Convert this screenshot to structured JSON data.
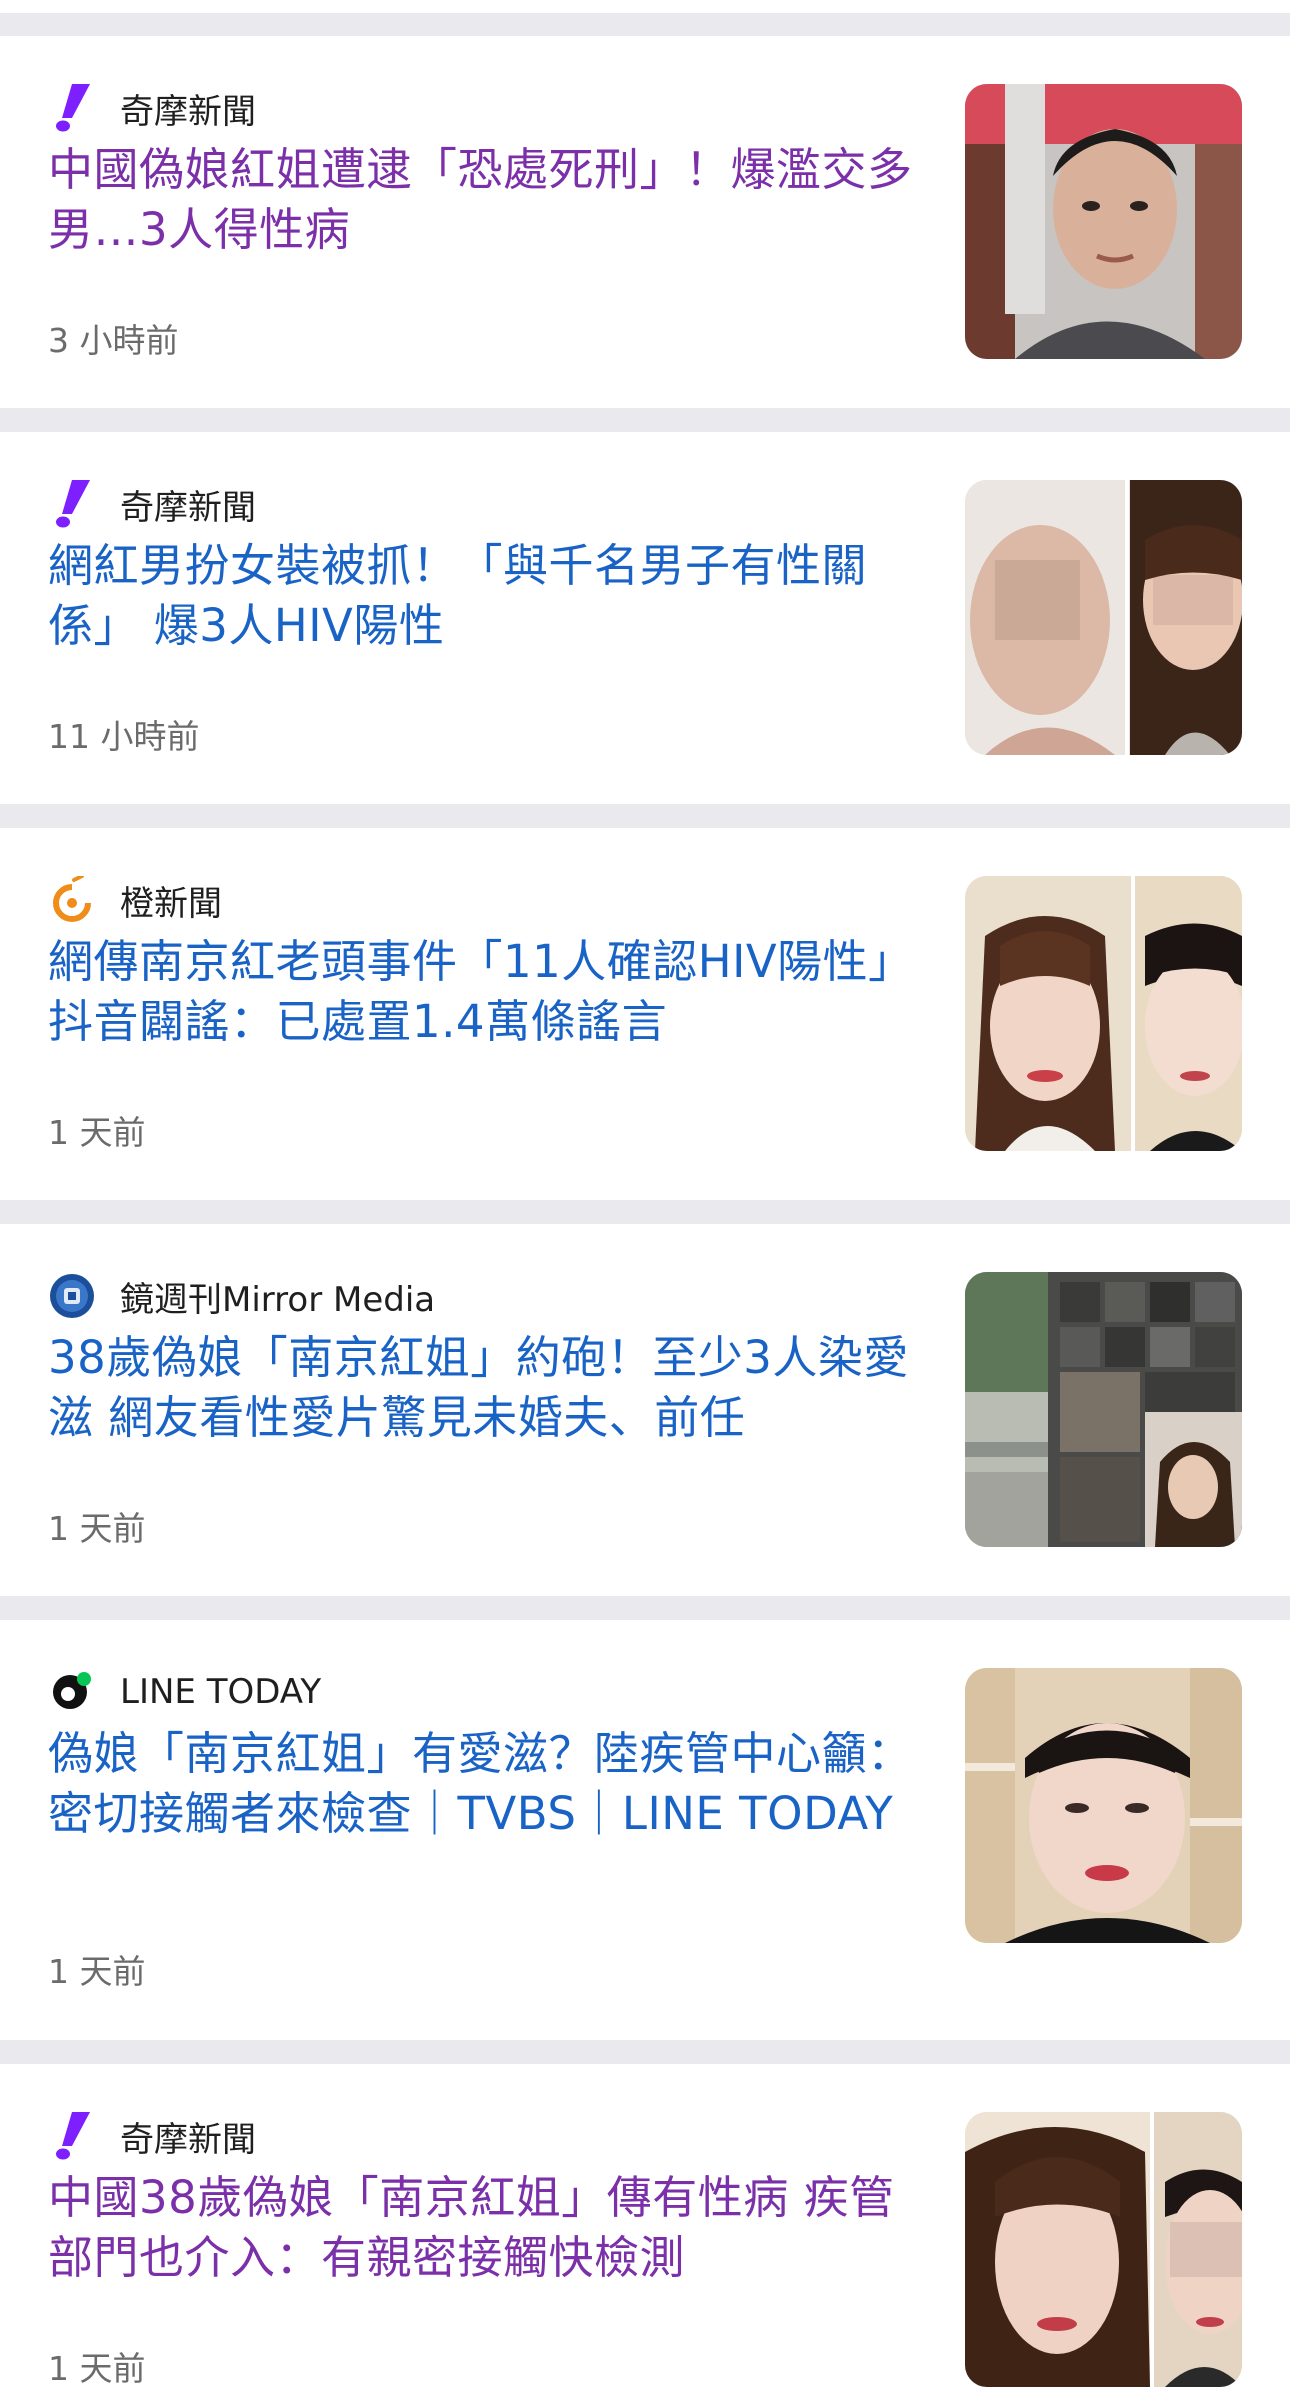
{
  "articles": [
    {
      "source": "奇摩新聞",
      "source_icon": "yahoo-exclamation-icon",
      "title": "中國偽娘紅姐遭逮「恐處死刑」！爆濫交多男…3人得性病",
      "time": "3 小時前",
      "visited": true,
      "thumbnail": "man-selfie-thumbnail"
    },
    {
      "source": "奇摩新聞",
      "source_icon": "yahoo-exclamation-icon",
      "title": "網紅男扮女裝被抓！「與千名男子有性關係」 爆3人HIV陽性",
      "time": "11 小時前",
      "visited": false,
      "thumbnail": "split-faces-thumbnail"
    },
    {
      "source": "橙新聞",
      "source_icon": "orange-news-icon",
      "title": "網傳南京紅老頭事件「11人確認HIV陽性」 抖音闢謠：已處置1.4萬條謠言",
      "time": "1 天前",
      "visited": false,
      "thumbnail": "split-faces-thumbnail"
    },
    {
      "source": "鏡週刊Mirror Media",
      "source_icon": "mirror-media-icon",
      "title": "38歲偽娘「南京紅姐」約砲！至少3人染愛滋 網友看性愛片驚見未婚夫、前任",
      "time": "1 天前",
      "visited": false,
      "thumbnail": "collage-thumbnail"
    },
    {
      "source": "LINE TODAY",
      "source_icon": "line-today-icon",
      "title": "偽娘「南京紅姐」有愛滋？陸疾管中心籲：密切接觸者來檢查｜TVBS｜LINE TODAY",
      "time": "1 天前",
      "visited": false,
      "thumbnail": "face-closeup-thumbnail"
    },
    {
      "source": "奇摩新聞",
      "source_icon": "yahoo-exclamation-icon",
      "title": "中國38歲偽娘「南京紅姐」傳有性病 疾管部門也介入：有親密接觸快檢測",
      "time": "1 天前",
      "visited": true,
      "thumbnail": "split-faces-thumbnail"
    }
  ],
  "colors": {
    "visited_link": "#7b2fa8",
    "unvisited_link": "#1a63c6",
    "separator": "#e9e9ee",
    "yahoo_purple": "#7e1fff"
  }
}
